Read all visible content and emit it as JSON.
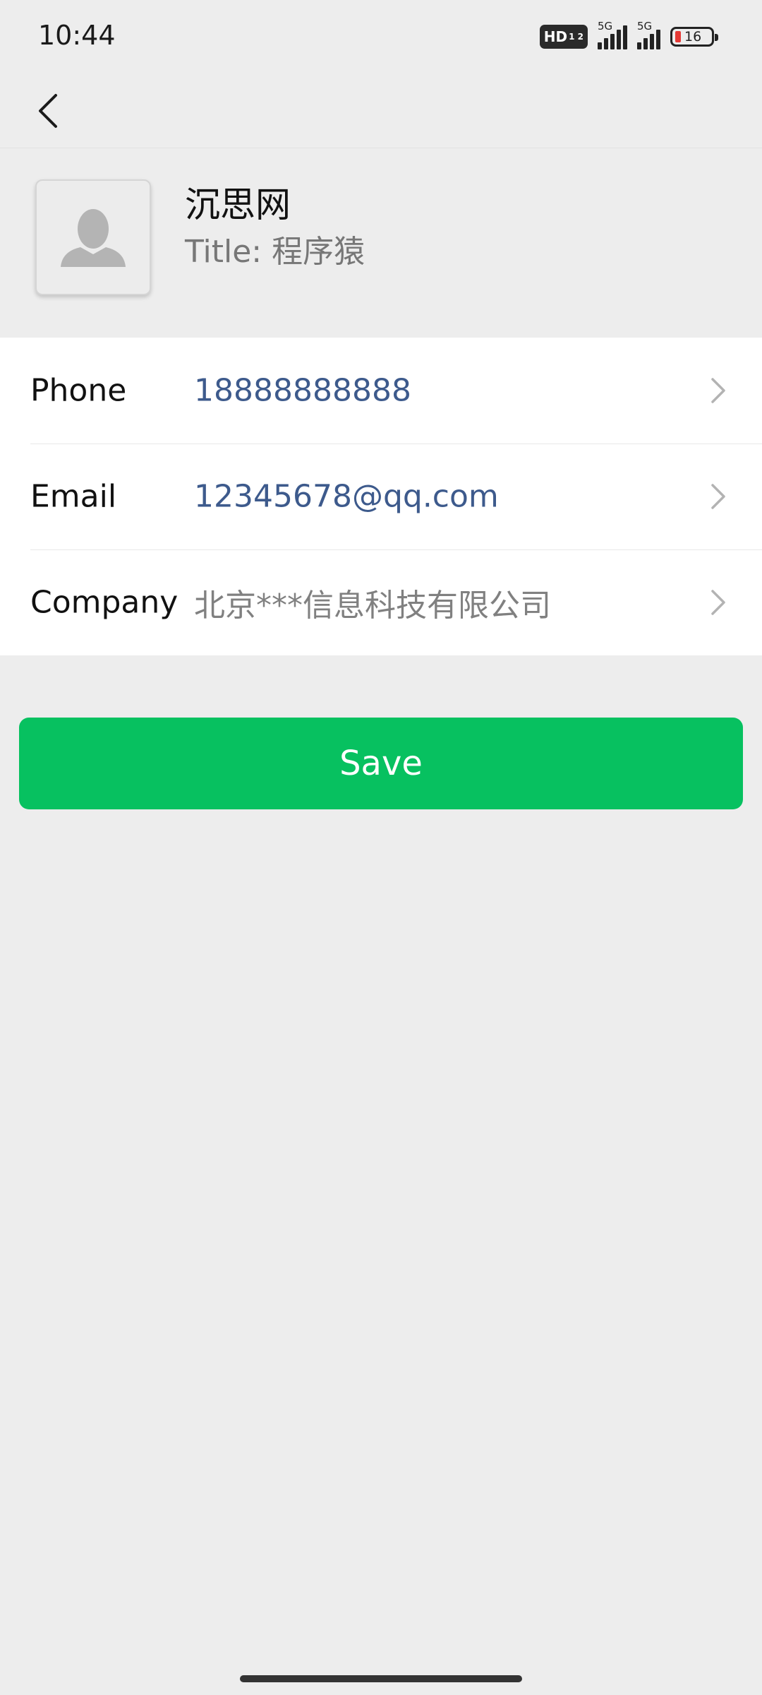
{
  "status_bar": {
    "time": "10:44",
    "hd_label": "HD",
    "hd_sub": "1 2",
    "signal1_label": "5G",
    "signal2_label": "5G",
    "battery_level": "16",
    "battery_color": "#e53935"
  },
  "nav": {
    "back_icon": "chevron-left-icon"
  },
  "profile": {
    "name": "沉思网",
    "title": "Title: 程序猿",
    "avatar_icon": "person-silhouette-icon"
  },
  "fields": {
    "phone_label": "Phone",
    "phone_value": "18888888888",
    "email_label": "Email",
    "email_value": "12345678@qq.com",
    "company_label": "Company",
    "company_value": "北京***信息科技有限公司"
  },
  "actions": {
    "save_label": "Save",
    "save_color": "#07c160"
  }
}
